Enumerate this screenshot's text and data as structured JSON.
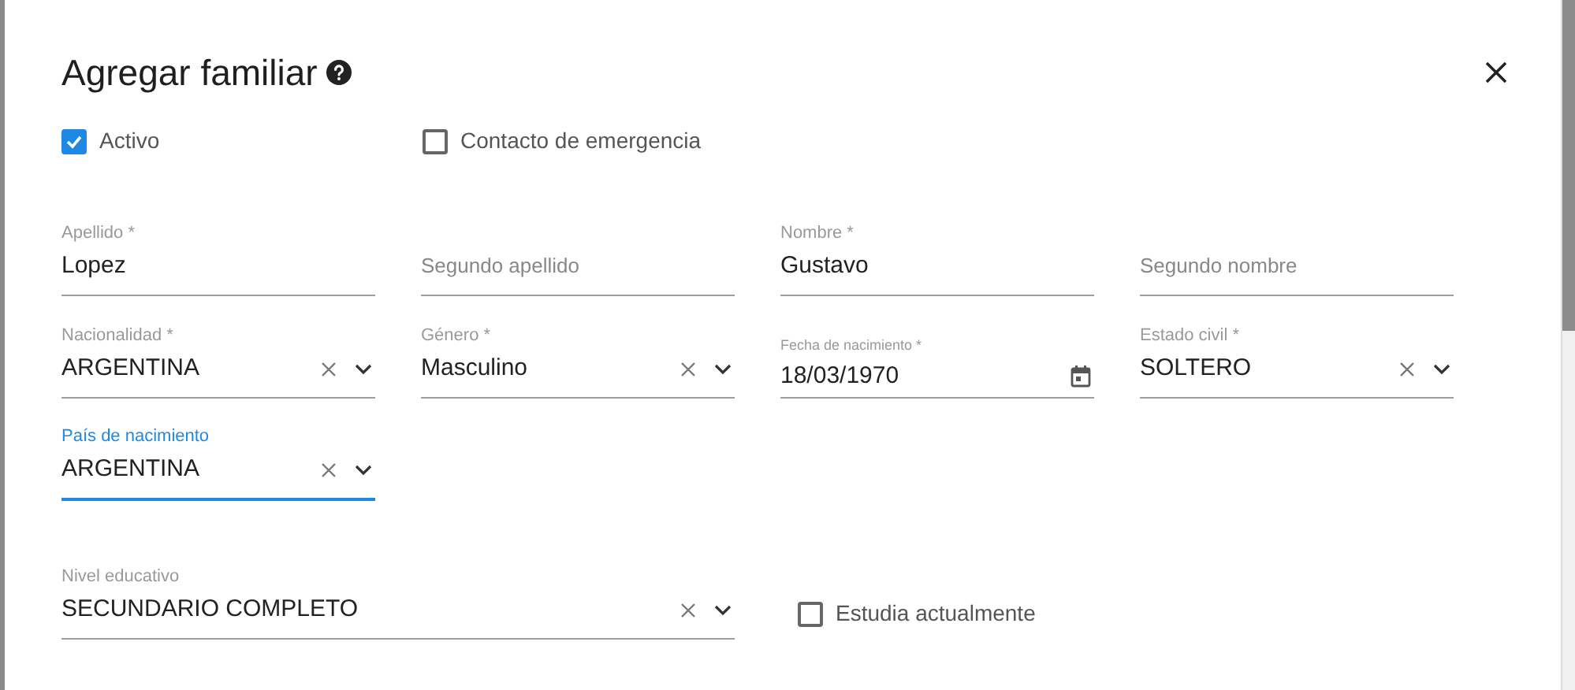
{
  "dialog": {
    "title": "Agregar familiar",
    "help": true,
    "closable": true
  },
  "checkboxes": [
    {
      "label": "Activo",
      "checked": true
    },
    {
      "label": "Contacto de emergencia",
      "checked": false
    }
  ],
  "field_rows": [
    [
      {
        "kind": "text",
        "label": "Apellido *",
        "value": "Lopez"
      },
      {
        "kind": "text",
        "placeholder": "Segundo apellido"
      },
      {
        "kind": "text",
        "label": "Nombre *",
        "value": "Gustavo"
      },
      {
        "kind": "text",
        "placeholder": "Segundo nombre"
      }
    ],
    [
      {
        "kind": "select",
        "label": "Nacionalidad *",
        "value": "ARGENTINA",
        "clearable": true
      },
      {
        "kind": "select",
        "label": "Género *",
        "value": "Masculino",
        "clearable": true
      },
      {
        "kind": "date",
        "label": "Fecha de nacimiento *",
        "value": "18/03/1970"
      },
      {
        "kind": "select",
        "label": "Estado civil *",
        "value": "SOLTERO",
        "clearable": true
      }
    ],
    [
      {
        "kind": "select",
        "label": "País de nacimiento",
        "value": "ARGENTINA",
        "clearable": true,
        "focused": true
      }
    ]
  ],
  "education": {
    "field": {
      "kind": "select",
      "label": "Nivel educativo",
      "value": "SECUNDARIO COMPLETO",
      "clearable": true
    },
    "checkbox": {
      "label": "Estudia actualmente",
      "checked": false
    }
  }
}
